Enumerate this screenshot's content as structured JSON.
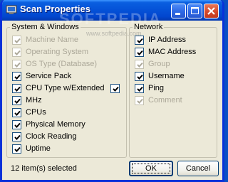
{
  "window": {
    "title": "Scan Properties"
  },
  "watermark": {
    "text": "SOFTPEDIA",
    "url": "www.softpedia.com"
  },
  "system_windows": {
    "title": "System & Windows",
    "items": [
      {
        "label": "Machine Name",
        "checked": true,
        "enabled": false
      },
      {
        "label": "Operating System",
        "checked": true,
        "enabled": false
      },
      {
        "label": "OS Type (Database)",
        "checked": true,
        "enabled": false
      },
      {
        "label": "Service Pack",
        "checked": true,
        "enabled": true
      },
      {
        "label": "CPU Type  w/Extended",
        "checked": true,
        "enabled": true
      },
      {
        "label": "MHz",
        "checked": true,
        "enabled": true
      },
      {
        "label": "CPUs",
        "checked": true,
        "enabled": true
      },
      {
        "label": "Physical Memory",
        "checked": true,
        "enabled": true
      },
      {
        "label": "Clock Reading",
        "checked": true,
        "enabled": true
      },
      {
        "label": "Uptime",
        "checked": true,
        "enabled": true
      }
    ],
    "extended_checked": true
  },
  "network": {
    "title": "Network",
    "items": [
      {
        "label": "IP Address",
        "checked": true,
        "enabled": true
      },
      {
        "label": "MAC Address",
        "checked": true,
        "enabled": true
      },
      {
        "label": "Group",
        "checked": true,
        "enabled": false
      },
      {
        "label": "Username",
        "checked": true,
        "enabled": true
      },
      {
        "label": "Ping",
        "checked": true,
        "enabled": true
      },
      {
        "label": "Comment",
        "checked": true,
        "enabled": false
      }
    ]
  },
  "status": {
    "text": "12 item(s) selected"
  },
  "buttons": {
    "ok": "OK",
    "cancel": "Cancel"
  }
}
